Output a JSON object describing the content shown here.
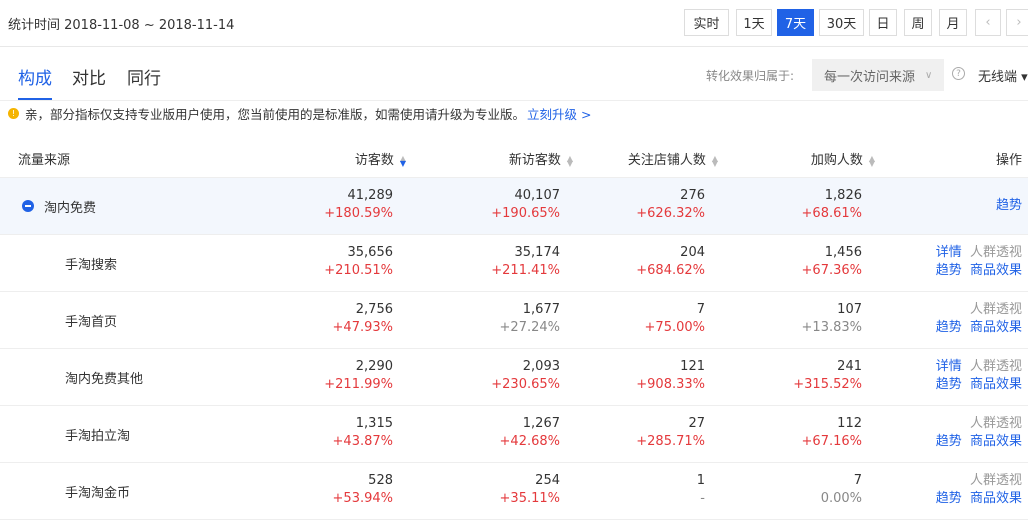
{
  "header": {
    "stat_time": "统计时间 2018-11-08 ~ 2018-11-14",
    "ranges": [
      "实时",
      "1天",
      "7天",
      "30天",
      "日",
      "周",
      "月"
    ],
    "active_range": "7天",
    "prev": "‹",
    "next": "›"
  },
  "tabs": [
    "构成",
    "对比",
    "同行"
  ],
  "active_tab": "构成",
  "conversion": {
    "label": "转化效果归属于:",
    "value": "每一次访问来源",
    "help": "?",
    "device": "无线端 ▾"
  },
  "notice": {
    "text": "亲，部分指标仅支持专业版用户使用，您当前使用的是标准版，如需使用请升级为专业版。",
    "link": "立刻升级 >"
  },
  "columns": [
    "流量来源",
    "访客数",
    "新访客数",
    "关注店铺人数",
    "加购人数",
    "操作"
  ],
  "ops": {
    "detail": "详情",
    "trend": "趋势",
    "crowd": "人群透视",
    "product": "商品效果"
  },
  "rows": [
    {
      "name": "淘内免费",
      "parent": true,
      "visitors": "41,289",
      "visitors_chg": "+180.59%",
      "new": "40,107",
      "new_chg": "+190.65%",
      "follow": "276",
      "follow_chg": "+626.32%",
      "cart": "1,826",
      "cart_chg": "+68.61%"
    },
    {
      "name": "手淘搜索",
      "visitors": "35,656",
      "visitors_chg": "+210.51%",
      "new": "35,174",
      "new_chg": "+211.41%",
      "follow": "204",
      "follow_chg": "+684.62%",
      "cart": "1,456",
      "cart_chg": "+67.36%",
      "detail": true
    },
    {
      "name": "手淘首页",
      "visitors": "2,756",
      "visitors_chg": "+47.93%",
      "new": "1,677",
      "new_chg": "+27.24%",
      "new_gray": true,
      "follow": "7",
      "follow_chg": "+75.00%",
      "cart": "107",
      "cart_chg": "+13.83%",
      "cart_gray": true
    },
    {
      "name": "淘内免费其他",
      "visitors": "2,290",
      "visitors_chg": "+211.99%",
      "new": "2,093",
      "new_chg": "+230.65%",
      "follow": "121",
      "follow_chg": "+908.33%",
      "cart": "241",
      "cart_chg": "+315.52%",
      "detail": true
    },
    {
      "name": "手淘拍立淘",
      "visitors": "1,315",
      "visitors_chg": "+43.87%",
      "new": "1,267",
      "new_chg": "+42.68%",
      "follow": "27",
      "follow_chg": "+285.71%",
      "cart": "112",
      "cart_chg": "+67.16%"
    },
    {
      "name": "手淘淘金币",
      "visitors": "528",
      "visitors_chg": "+53.94%",
      "new": "254",
      "new_chg": "+35.11%",
      "follow": "1",
      "follow_chg": "-",
      "follow_gray": true,
      "cart": "7",
      "cart_chg": "0.00%",
      "cart_gray": true
    }
  ]
}
